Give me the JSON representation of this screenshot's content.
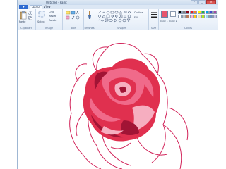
{
  "window": {
    "title": "Untitled - Paint"
  },
  "tabs": {
    "file": "",
    "home": "Home",
    "view": "View"
  },
  "ribbon": {
    "clipboard": {
      "label": "Clipboard",
      "paste": "Paste"
    },
    "image": {
      "label": "Image",
      "select": "Select",
      "crop": "Crop",
      "resize": "Resize",
      "rotate": "Rotate"
    },
    "tools": {
      "label": "Tools"
    },
    "brushes": {
      "label": "Brushes"
    },
    "shapes": {
      "label": "Shapes",
      "outline": "Outline",
      "fill": "Fill"
    },
    "size": {
      "label": "Size"
    },
    "colors": {
      "label": "Colors",
      "color1": "Color 1",
      "color2": "Color 2",
      "color1_value": "#e8566e",
      "color2_value": "#ffffff",
      "palette_row1": [
        "#000000",
        "#7f7f7f",
        "#880015",
        "#ed1c24",
        "#ff7f27",
        "#fff200",
        "#22b14c",
        "#00a2e8",
        "#3f48cc",
        "#a349a4"
      ],
      "palette_row2": [
        "#ffffff",
        "#c3c3c3",
        "#b97a57",
        "#ffaec9",
        "#ffc90e",
        "#efe4b0",
        "#b5e61d",
        "#99d9ea",
        "#7092be",
        "#c8bfe7"
      ]
    }
  },
  "canvas": {
    "subject": "rose",
    "colors": {
      "outline": "#d2245a",
      "petal_main": "#e0304f",
      "petal_light": "#f06a8a",
      "petal_pale": "#f6aec0",
      "petal_dark": "#a11435"
    }
  }
}
